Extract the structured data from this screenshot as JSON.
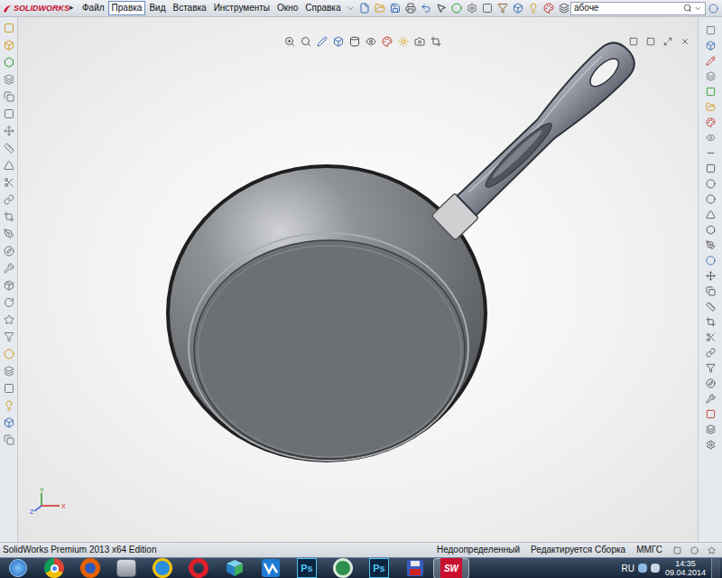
{
  "app": {
    "logo": "SOLIDWORKS",
    "menu_arrow": "▸"
  },
  "menu": [
    {
      "label": "Файл",
      "selected": false
    },
    {
      "label": "Правка",
      "selected": true
    },
    {
      "label": "Вид",
      "selected": false
    },
    {
      "label": "Вставка",
      "selected": false
    },
    {
      "label": "Инструменты",
      "selected": false
    },
    {
      "label": "Окно",
      "selected": false
    },
    {
      "label": "Справка",
      "selected": false
    }
  ],
  "search": {
    "value": "абоче"
  },
  "triad": [
    {
      "axis": "Y",
      "color": "#2e9b2e"
    },
    {
      "axis": "Z",
      "color": "#2a4fd6"
    },
    {
      "axis": "X",
      "color": "#d42a2a"
    }
  ],
  "status_bar": {
    "product": "SolidWorks Premium 2013 x64 Edition",
    "state": "Недоопределенный",
    "mode": "Редактируется Сборка",
    "units": "ММГС"
  },
  "taskbar": {
    "apps": [
      {
        "kind": "chrome",
        "selected": false
      },
      {
        "kind": "firefox",
        "selected": false
      },
      {
        "kind": "explorer",
        "selected": false
      },
      {
        "kind": "ie",
        "selected": false
      },
      {
        "kind": "opera",
        "selected": false
      },
      {
        "kind": "box",
        "selected": false
      },
      {
        "kind": "maps",
        "selected": false
      },
      {
        "kind": "ps",
        "label": "Ps",
        "selected": false
      },
      {
        "kind": "app6",
        "selected": false
      },
      {
        "kind": "ps",
        "label": "Ps",
        "selected": false
      },
      {
        "kind": "disk",
        "selected": false
      },
      {
        "kind": "solidworks",
        "label": "SW",
        "selected": true
      }
    ],
    "language": "RU",
    "time": "14:35",
    "date": "09.04.2014"
  }
}
